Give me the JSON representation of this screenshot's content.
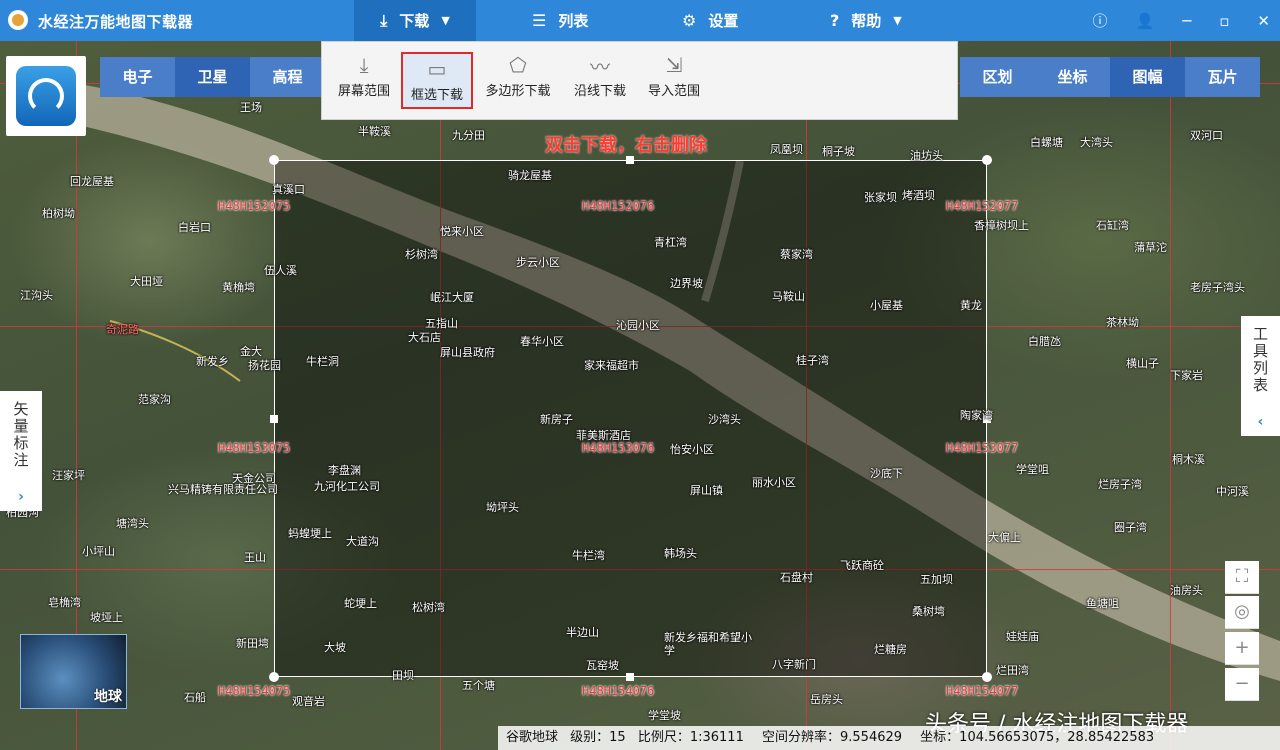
{
  "app": {
    "title": "水经注万能地图下载器"
  },
  "menu": {
    "download": "下载",
    "list": "列表",
    "settings": "设置",
    "help": "帮助"
  },
  "map_types": [
    "电子",
    "卫星",
    "高程"
  ],
  "map_type_active": "卫星",
  "layer_tabs": [
    "区划",
    "坐标",
    "图幅",
    "瓦片"
  ],
  "layer_tab_active": "图幅",
  "download_menu": {
    "items": [
      {
        "label": "屏幕范围",
        "icon": "download-arrow-icon"
      },
      {
        "label": "框选下载",
        "icon": "rectangle-select-icon",
        "active": true
      },
      {
        "label": "多边形下载",
        "icon": "polygon-icon"
      },
      {
        "label": "沿线下载",
        "icon": "polyline-icon"
      },
      {
        "label": "导入范围",
        "icon": "import-icon"
      }
    ]
  },
  "selection_hint": "双击下载，右击删除",
  "sheet_labels": [
    "H48H152075",
    "H48H152076",
    "H48H152077",
    "H48H153075",
    "H48H153076",
    "H48H153077",
    "H48H154075",
    "H48H154076",
    "H48H154077"
  ],
  "places": [
    "王场",
    "半鞍溪",
    "九分田",
    "骑龙屋基",
    "凤凰坝",
    "桐子坡",
    "油坊头",
    "白螺塘",
    "大湾头",
    "双河口",
    "回龙屋基",
    "柏树坳",
    "白岩口",
    "真溪口",
    "杉树湾",
    "悦来小区",
    "步云小区",
    "青杠湾",
    "张家坝",
    "烤酒坝",
    "香樟树坝上",
    "石缸湾",
    "蒲草沱",
    "大田垭",
    "伍人溪",
    "黄桷塆",
    "江沟头",
    "岷江大厦",
    "边界坡",
    "马鞍山",
    "蔡家湾",
    "小屋基",
    "黄龙",
    "老房子湾头",
    "五指山",
    "大石店",
    "屏山县政府",
    "春华小区",
    "沁园小区",
    "茶林坳",
    "奇泥路",
    "金大",
    "扬花园",
    "牛栏洞",
    "家来福超市",
    "桂子湾",
    "白腊氹",
    "横山子",
    "下家岩",
    "新发乡",
    "范家沟",
    "新房子",
    "菲美斯酒店",
    "怡安小区",
    "沙湾头",
    "陶家湾",
    "桐木溪",
    "汪家坪",
    "天金公司",
    "李盘渊",
    "九河化工公司",
    "屏山镇",
    "丽水小区",
    "沙底下",
    "学堂咀",
    "烂房子湾",
    "中河溪",
    "兴马精铸有限责任公司",
    "坳坪头",
    "柏园沟",
    "大偏上",
    "圈子湾",
    "塘湾头",
    "蚂蝗埂上",
    "大道沟",
    "牛栏湾",
    "韩场头",
    "飞跃商砼",
    "石盘村",
    "五加坝",
    "油房头",
    "小坪山",
    "王山",
    "蛇埂上",
    "松树湾",
    "桑树塆",
    "鱼塘咀",
    "皂桷湾",
    "坡垭上",
    "新田塆",
    "半边山",
    "新发乡福和希望小学",
    "烂糖房",
    "娃娃庙",
    "大坡",
    "瓦窑坡",
    "八字新门",
    "烂田湾",
    "田坝",
    "五个塘",
    "石船",
    "观音岩",
    "岳房头",
    "学堂坡"
  ],
  "side_left": "矢量标注",
  "side_right": "工具列表",
  "globe_label": "地球",
  "status": {
    "source": "谷歌地球",
    "level": "级别：15",
    "scale": "比例尺：1:36111",
    "resolution": "空间分辨率：9.554629",
    "coord": "坐标：104.56653075，28.85422583"
  },
  "watermark": "头条号 / 水经注地图下载器",
  "colors": {
    "titlebar": "#2e87d8",
    "active_tab": "#2f63b3",
    "grid": "#d9363e",
    "highlight": "#e02a2a"
  }
}
